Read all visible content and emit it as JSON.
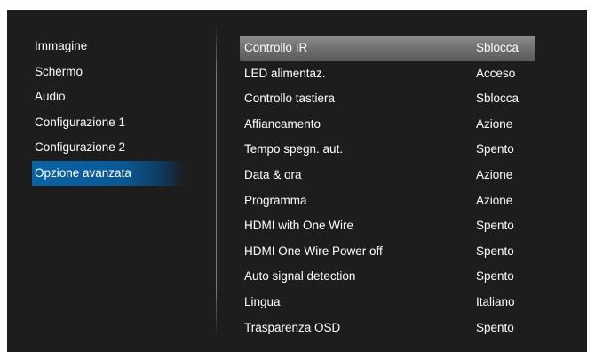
{
  "sidebar": {
    "items": [
      {
        "label": "Immagine"
      },
      {
        "label": "Schermo"
      },
      {
        "label": "Audio"
      },
      {
        "label": "Configurazione 1"
      },
      {
        "label": "Configurazione 2"
      },
      {
        "label": "Opzione avanzata"
      }
    ],
    "selected": "Opzione avanzata"
  },
  "settings": {
    "highlighted": "Controllo IR",
    "rows": [
      {
        "label": "Controllo IR",
        "value": "Sblocca"
      },
      {
        "label": "LED alimentaz.",
        "value": "Acceso"
      },
      {
        "label": "Controllo tastiera",
        "value": "Sblocca"
      },
      {
        "label": "Affiancamento",
        "value": "Azione"
      },
      {
        "label": "Tempo spegn. aut.",
        "value": "Spento"
      },
      {
        "label": "Data & ora",
        "value": "Azione"
      },
      {
        "label": "Programma",
        "value": "Azione"
      },
      {
        "label": "HDMI with One Wire",
        "value": "Spento"
      },
      {
        "label": "HDMI One Wire Power off",
        "value": "Spento"
      },
      {
        "label": "Auto signal detection",
        "value": "Spento"
      },
      {
        "label": "Lingua",
        "value": "Italiano"
      },
      {
        "label": "Trasparenza OSD",
        "value": "Spento"
      }
    ]
  },
  "colors": {
    "background": "#1d1d1d",
    "selected_item": "#0a63a5",
    "highlight_row": "#6f6f6f",
    "text": "#ffffff"
  }
}
